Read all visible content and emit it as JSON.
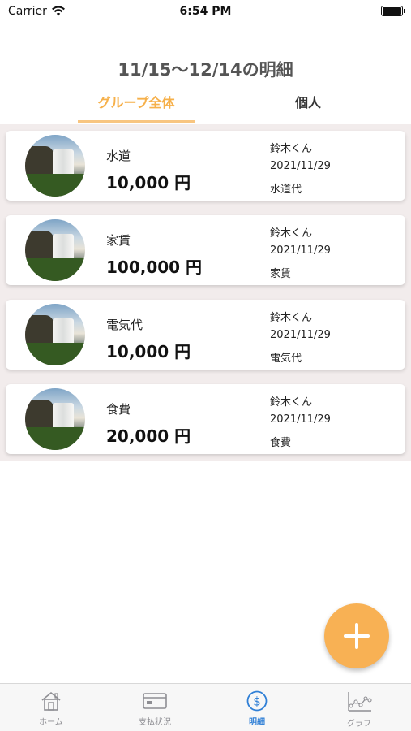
{
  "status": {
    "carrier": "Carrier",
    "time": "6:54 PM"
  },
  "title": "11/15〜12/14の明細",
  "tabs": [
    {
      "label": "グループ全体",
      "active": true
    },
    {
      "label": "個人",
      "active": false
    }
  ],
  "entries": [
    {
      "category": "水道",
      "amount": "10,000 円",
      "user": "鈴木くん",
      "date": "2021/11/29",
      "memo": "水道代"
    },
    {
      "category": "家賃",
      "amount": "100,000 円",
      "user": "鈴木くん",
      "date": "2021/11/29",
      "memo": "家賃"
    },
    {
      "category": "電気代",
      "amount": "10,000 円",
      "user": "鈴木くん",
      "date": "2021/11/29",
      "memo": "電気代"
    },
    {
      "category": "食費",
      "amount": "20,000 円",
      "user": "鈴木くん",
      "date": "2021/11/29",
      "memo": "食費"
    }
  ],
  "fab": {
    "icon": "plus-icon"
  },
  "tabbar": [
    {
      "label": "ホーム",
      "icon": "home-icon",
      "active": false
    },
    {
      "label": "支払状況",
      "icon": "card-icon",
      "active": false
    },
    {
      "label": "明細",
      "icon": "dollar-icon",
      "active": true
    },
    {
      "label": "グラフ",
      "icon": "chart-icon",
      "active": false
    }
  ],
  "colors": {
    "accent": "#f8b154",
    "tab_active": "#f6b04a",
    "tabbar_active": "#2f7fd6",
    "list_bg": "#f2ecec"
  }
}
